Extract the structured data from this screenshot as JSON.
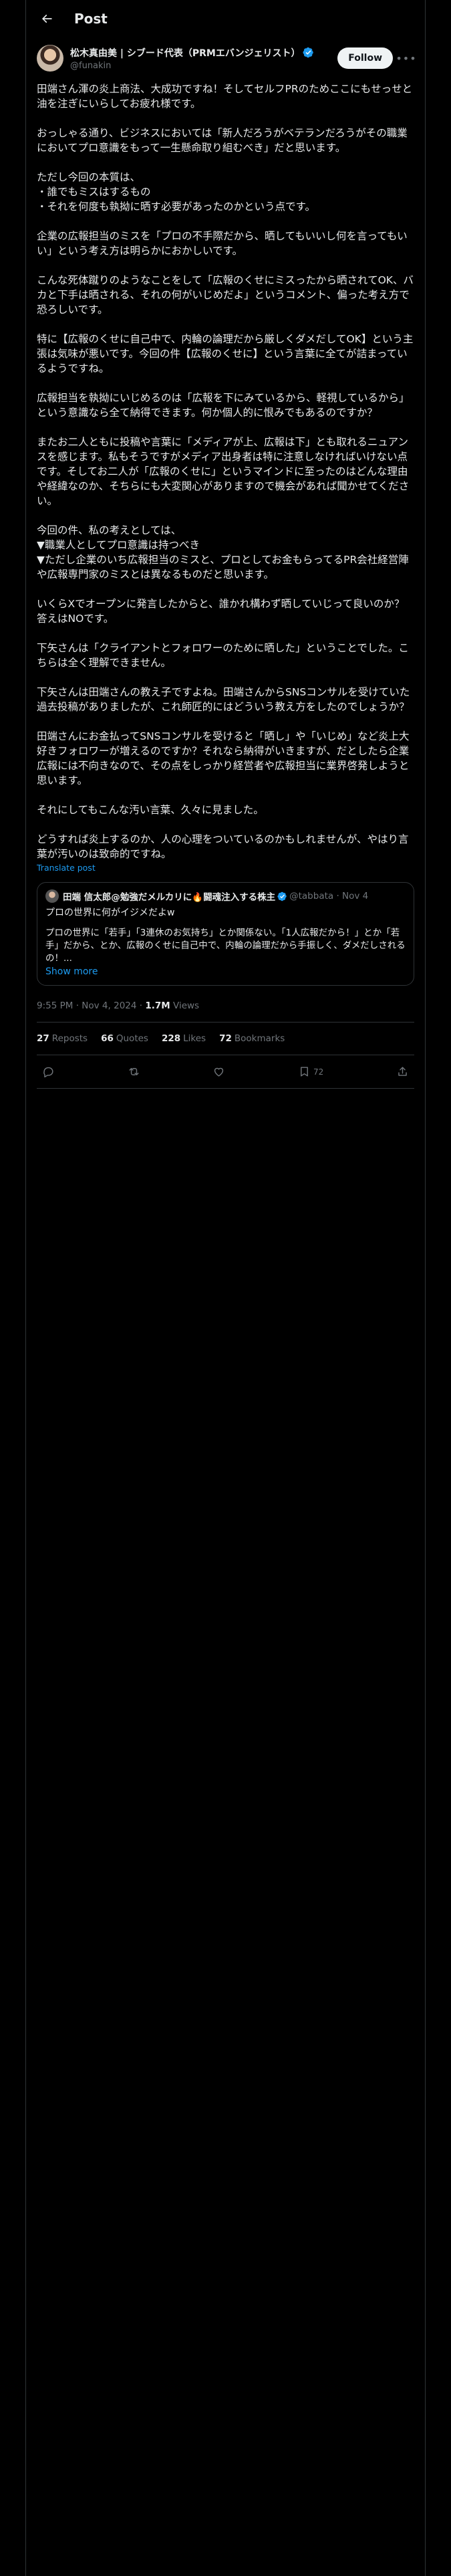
{
  "topbar": {
    "title": "Post"
  },
  "author": {
    "name": "松木真由美 | シブード代表（PRMエバンジェリスト）",
    "handle": "@funakin",
    "follow_label": "Follow",
    "verified": true
  },
  "post": {
    "paragraphs": [
      "田端さん渾の炎上商法、大成功ですね！そしてセルフPRのためここにもせっせと油を注ぎにいらしてお疲れ様です。",
      "おっしゃる通り、ビジネスにおいては「新人だろうがベテランだろうがその職業においてプロ意識をもって一生懸命取り組むべき」だと思います。",
      "ただし今回の本質は、\n・誰でもミスはするもの\n・それを何度も執拗に晒す必要があったのかという点です。",
      "企業の広報担当のミスを「プロの不手際だから、晒してもいいし何を言ってもいい」という考え方は明らかにおかしいです。",
      "こんな死体蹴りのようなことをして「広報のくせにミスったから晒されてOK、バカと下手は晒される、それの何がいじめだよ」というコメント、偏った考え方で恐ろしいです。",
      "特に【広報のくせに自己中で、内輪の論理だから厳しくダメだしてOK】という主張は気味が悪いです。今回の件【広報のくせに】という言葉に全てが詰まっているようですね。",
      "広報担当を執拗にいじめるのは「広報を下にみているから、軽視しているから」という意識なら全て納得できます。何か個人的に恨みでもあるのですか？",
      "またお二人ともに投稿や言葉に「メディアが上、広報は下」とも取れるニュアンスを感じます。私もそうですがメディア出身者は特に注意しなければいけない点です。そしてお二人が「広報のくせに」というマインドに至ったのはどんな理由や経緯なのか、そちらにも大変関心がありますので機会があれば聞かせてください。",
      "今回の件、私の考えとしては、\n▼職業人としてプロ意識は持つべき\n▼ただし企業のいち広報担当のミスと、プロとしてお金もらってるPR会社経営陣や広報専門家のミスとは異なるものだと思います。",
      "いくらXでオープンに発言したからと、誰かれ構わず晒していじって良いのか？答えはNOです。",
      "下矢さんは「クライアントとフォロワーのために晒した」ということでした。こちらは全く理解できません。",
      "下矢さんは田端さんの教え子ですよね。田端さんからSNSコンサルを受けていた過去投稿がありましたが、これ師匠的にはどういう教え方をしたのでしょうか？",
      "田端さんにお金払ってSNSコンサルを受けると「晒し」や「いじめ」など炎上大好きフォロワーが増えるのですか？それなら納得がいきますが、だとしたら企業広報には不向きなので、その点をしっかり経営者や広報担当に業界啓発しようと思います。",
      "それにしてもこんな汚い言葉、久々に見ました。",
      "どうすれば炎上するのか、人の心理をついているのかもしれませんが、やはり言葉が汚いのは致命的ですね。"
    ],
    "translate_label": "Translate post"
  },
  "quote": {
    "name": "田端 信太郎@勉強だメルカリに🔥闘魂注入する株主",
    "handle": "@tabbata",
    "date": "Nov 4",
    "title": "プロの世界に何がイジメだよw",
    "text": "プロの世界に「若手」「3連休のお気持ち」とか関係ない。「1人広報だから！」とか「若手」だから、とか、広報のくせに自己中で、内輪の論理だから手振しく、ダメだしされるの！...",
    "show_more": "Show more"
  },
  "meta": {
    "time": "9:55 PM",
    "date": "Nov 4, 2024",
    "views_count": "1.7M",
    "views_label": "Views"
  },
  "stats": [
    {
      "count": "27",
      "label": "Reposts"
    },
    {
      "count": "66",
      "label": "Quotes"
    },
    {
      "count": "228",
      "label": "Likes"
    },
    {
      "count": "72",
      "label": "Bookmarks"
    }
  ],
  "actions": {
    "bookmark_count": "72"
  },
  "colors": {
    "background": "#000000",
    "text": "#e7e9ea",
    "muted": "#71767b",
    "accent": "#1d9bf0",
    "border": "#2f3336"
  },
  "icons": [
    "back-arrow-icon",
    "verified-badge-icon",
    "more-icon",
    "reply-icon",
    "repost-icon",
    "like-icon",
    "bookmark-icon",
    "share-icon"
  ]
}
